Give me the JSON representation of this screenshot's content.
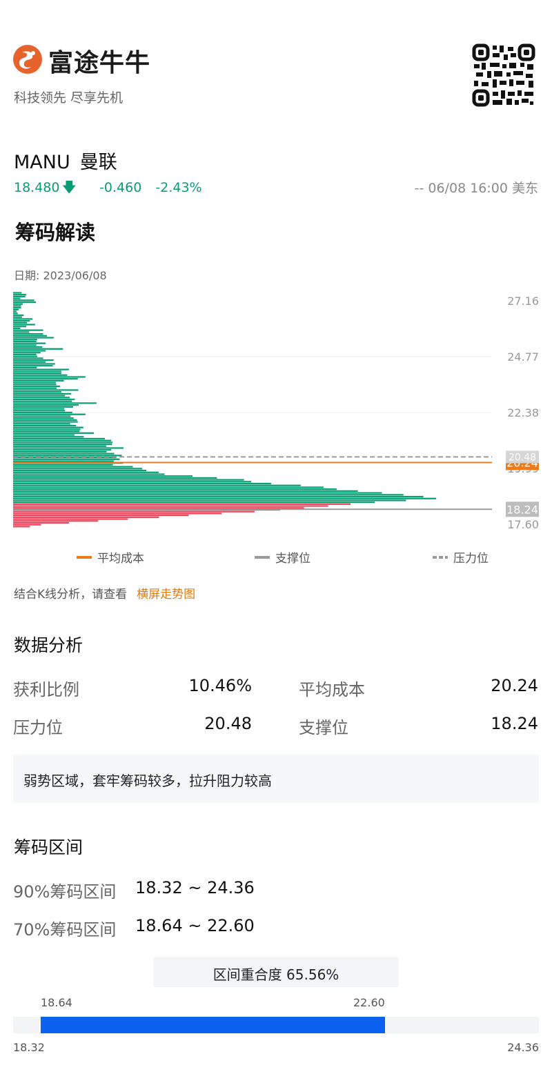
{
  "header": {
    "brand_name": "富途牛牛",
    "slogan": "科技领先 尽享先机",
    "brand_color": "#e8622c"
  },
  "stock": {
    "code": "MANU",
    "name": "曼联",
    "price": "18.480",
    "change": "-0.460",
    "change_pct": "-2.43%",
    "market_time": "-- 06/08 16:00 美东",
    "down_color": "#0b9b74"
  },
  "section_title": "筹码解读",
  "date_label": "日期: 2023/06/08",
  "chart_data": {
    "type": "bar",
    "orientation": "horizontal",
    "y_axis_ticks": [
      27.16,
      24.77,
      22.38,
      19.99,
      17.6
    ],
    "ylim": [
      17.6,
      27.16
    ],
    "markers": [
      {
        "label": "20.24",
        "value": 20.24,
        "kind": "平均成本",
        "color": "#ee7a1c"
      },
      {
        "label": "18.24",
        "value": 18.24,
        "kind": "支撑位",
        "color": "#999999"
      },
      {
        "label": "20.48",
        "value": 20.48,
        "kind": "压力位",
        "color": "#999999"
      }
    ],
    "profit_color": "#f0435b",
    "trapped_color": "#079f74",
    "bins": [
      [
        27.5,
        0.02
      ],
      [
        27.42,
        0.031
      ],
      [
        27.34,
        0.029
      ],
      [
        27.26,
        0.017
      ],
      [
        27.18,
        0.05
      ],
      [
        27.1,
        0.054
      ],
      [
        27.02,
        0.023
      ],
      [
        26.94,
        0.019
      ],
      [
        26.86,
        0.019
      ],
      [
        26.78,
        0.013
      ],
      [
        26.7,
        0.008
      ],
      [
        26.62,
        0.011
      ],
      [
        26.54,
        0.025
      ],
      [
        26.46,
        0.021
      ],
      [
        26.38,
        0.046
      ],
      [
        26.3,
        0.04
      ],
      [
        26.22,
        0.033
      ],
      [
        26.14,
        0.052
      ],
      [
        26.06,
        0.031
      ],
      [
        25.98,
        0.017
      ],
      [
        25.9,
        0.071
      ],
      [
        25.82,
        0.038
      ],
      [
        25.74,
        0.071
      ],
      [
        25.66,
        0.08
      ],
      [
        25.58,
        0.096
      ],
      [
        25.5,
        0.057
      ],
      [
        25.42,
        0.055
      ],
      [
        25.34,
        0.077
      ],
      [
        25.26,
        0.055
      ],
      [
        25.18,
        0.069
      ],
      [
        25.1,
        0.118
      ],
      [
        25.02,
        0.077
      ],
      [
        24.94,
        0.065
      ],
      [
        24.86,
        0.055
      ],
      [
        24.78,
        0.057
      ],
      [
        24.7,
        0.071
      ],
      [
        24.62,
        0.096
      ],
      [
        24.54,
        0.077
      ],
      [
        24.46,
        0.099
      ],
      [
        24.38,
        0.094
      ],
      [
        24.3,
        0.056
      ],
      [
        24.22,
        0.132
      ],
      [
        24.14,
        0.114
      ],
      [
        24.06,
        0.114
      ],
      [
        23.98,
        0.128
      ],
      [
        23.9,
        0.171
      ],
      [
        23.82,
        0.153
      ],
      [
        23.74,
        0.12
      ],
      [
        23.66,
        0.101
      ],
      [
        23.58,
        0.102
      ],
      [
        23.5,
        0.111
      ],
      [
        23.42,
        0.103
      ],
      [
        23.34,
        0.154
      ],
      [
        23.26,
        0.114
      ],
      [
        23.18,
        0.137
      ],
      [
        23.1,
        0.123
      ],
      [
        23.02,
        0.134
      ],
      [
        22.94,
        0.146
      ],
      [
        22.86,
        0.139
      ],
      [
        22.78,
        0.197
      ],
      [
        22.7,
        0.155
      ],
      [
        22.62,
        0.142
      ],
      [
        22.54,
        0.121
      ],
      [
        22.46,
        0.123
      ],
      [
        22.38,
        0.14
      ],
      [
        22.3,
        0.171
      ],
      [
        22.22,
        0.136
      ],
      [
        22.14,
        0.143
      ],
      [
        22.06,
        0.151
      ],
      [
        21.98,
        0.153
      ],
      [
        21.9,
        0.135
      ],
      [
        21.82,
        0.149
      ],
      [
        21.74,
        0.166
      ],
      [
        21.66,
        0.159
      ],
      [
        21.58,
        0.157
      ],
      [
        21.5,
        0.191
      ],
      [
        21.42,
        0.145
      ],
      [
        21.34,
        0.167
      ],
      [
        21.26,
        0.217
      ],
      [
        21.18,
        0.232
      ],
      [
        21.1,
        0.235
      ],
      [
        21.02,
        0.234
      ],
      [
        20.94,
        0.22
      ],
      [
        20.86,
        0.261
      ],
      [
        20.78,
        0.232
      ],
      [
        20.7,
        0.221
      ],
      [
        20.62,
        0.239
      ],
      [
        20.54,
        0.257
      ],
      [
        20.46,
        0.244
      ],
      [
        20.38,
        0.252
      ],
      [
        20.3,
        0.238
      ],
      [
        20.22,
        0.26
      ],
      [
        20.14,
        0.236
      ],
      [
        20.06,
        0.283
      ],
      [
        19.98,
        0.305
      ],
      [
        19.9,
        0.315
      ],
      [
        19.82,
        0.344
      ],
      [
        19.74,
        0.358
      ],
      [
        19.66,
        0.424
      ],
      [
        19.58,
        0.482
      ],
      [
        19.5,
        0.546
      ],
      [
        19.42,
        0.563
      ],
      [
        19.34,
        0.61
      ],
      [
        19.26,
        0.68
      ],
      [
        19.18,
        0.734
      ],
      [
        19.1,
        0.765
      ],
      [
        19.02,
        0.815
      ],
      [
        18.94,
        0.872
      ],
      [
        18.86,
        0.923
      ],
      [
        18.78,
        0.97
      ],
      [
        18.7,
        1.0
      ],
      [
        18.62,
        0.929
      ],
      [
        18.54,
        0.855
      ],
      [
        18.46,
        0.798
      ],
      [
        18.38,
        0.745
      ],
      [
        18.3,
        0.688
      ],
      [
        18.22,
        0.631
      ],
      [
        18.14,
        0.571
      ],
      [
        18.06,
        0.493
      ],
      [
        17.98,
        0.415
      ],
      [
        17.9,
        0.345
      ],
      [
        17.82,
        0.271
      ],
      [
        17.74,
        0.201
      ],
      [
        17.66,
        0.132
      ],
      [
        17.58,
        0.066
      ],
      [
        17.5,
        0.04
      ]
    ],
    "legend": [
      "平均成本",
      "支撑位",
      "压力位"
    ]
  },
  "hint": {
    "text": "结合K线分析，请查看",
    "link": "横屏走势图",
    "link_color": "#e07a16"
  },
  "analysis": {
    "title": "数据分析",
    "profit_ratio_label": "获利比例",
    "profit_ratio_value": "10.46%",
    "avg_cost_label": "平均成本",
    "avg_cost_value": "20.24",
    "pressure_label": "压力位",
    "pressure_value": "20.48",
    "support_label": "支撑位",
    "support_value": "18.24",
    "advice": "弱势区域，套牢筹码较多，拉升阻力较高"
  },
  "ranges": {
    "title": "筹码区间",
    "r90_label": "90%筹码区间",
    "r90_value": "18.32 ~ 24.36",
    "r70_label": "70%筹码区间",
    "r70_value": "18.64 ~ 22.60",
    "overlap_text": "区间重合度 65.56%",
    "inner_low": "18.64",
    "inner_high": "22.60",
    "outer_low": "18.32",
    "outer_high": "24.36",
    "inner_low_value": 18.64,
    "inner_high_value": 22.6,
    "outer_low_value": 18.32,
    "outer_high_value": 24.36,
    "bar_color": "#0b62f0"
  }
}
